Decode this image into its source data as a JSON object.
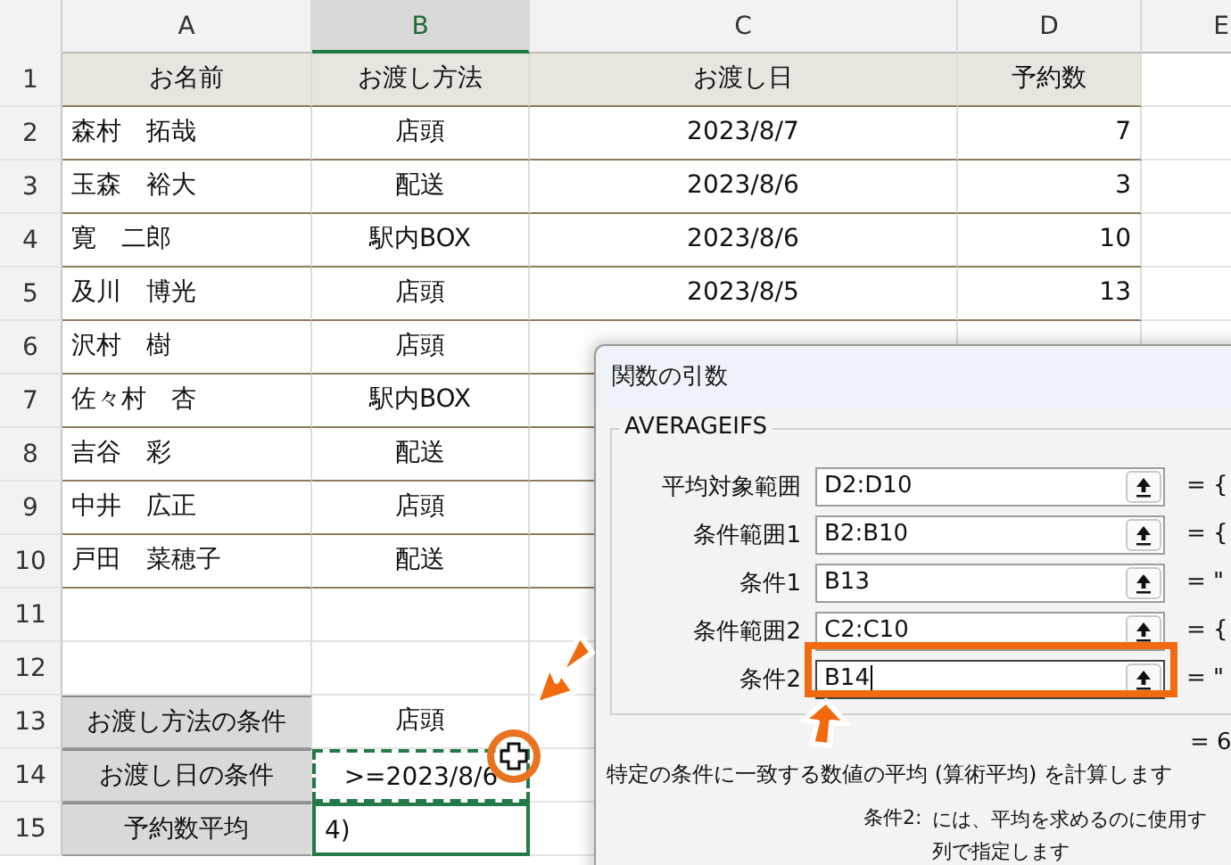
{
  "columns": [
    {
      "label": "A",
      "selected": false
    },
    {
      "label": "B",
      "selected": true
    },
    {
      "label": "C",
      "selected": false
    },
    {
      "label": "D",
      "selected": false
    },
    {
      "label": "E",
      "selected": false
    }
  ],
  "rows": [
    {
      "number": "1",
      "kind": "header",
      "cells": [
        "お名前",
        "お渡し方法",
        "お渡し日",
        "予約数"
      ]
    },
    {
      "number": "2",
      "kind": "data",
      "cells": [
        "森村　拓哉",
        "店頭",
        "2023/8/7",
        "7"
      ]
    },
    {
      "number": "3",
      "kind": "data",
      "cells": [
        "玉森　裕大",
        "配送",
        "2023/8/6",
        "3"
      ]
    },
    {
      "number": "4",
      "kind": "data",
      "cells": [
        "寛　二郎",
        "駅内BOX",
        "2023/8/6",
        "10"
      ]
    },
    {
      "number": "5",
      "kind": "data",
      "cells": [
        "及川　博光",
        "店頭",
        "2023/8/5",
        "13"
      ]
    },
    {
      "number": "6",
      "kind": "data",
      "cells": [
        "沢村　樹",
        "店頭"
      ]
    },
    {
      "number": "7",
      "kind": "data",
      "cells": [
        "佐々村　杏",
        "駅内BOX"
      ]
    },
    {
      "number": "8",
      "kind": "data",
      "cells": [
        "吉谷　彩",
        "配送"
      ]
    },
    {
      "number": "9",
      "kind": "data",
      "cells": [
        "中井　広正",
        "店頭"
      ]
    },
    {
      "number": "10",
      "kind": "data",
      "cells": [
        "戸田　菜穂子",
        "配送"
      ]
    },
    {
      "number": "11",
      "kind": "blank",
      "cells": []
    },
    {
      "number": "12",
      "kind": "blank",
      "cells": []
    },
    {
      "number": "13",
      "kind": "criteria",
      "cells": [
        "お渡し方法の条件",
        "店頭"
      ],
      "marquee": false,
      "editing": false
    },
    {
      "number": "14",
      "kind": "criteria",
      "cells": [
        "お渡し日の条件",
        ">=2023/8/6"
      ],
      "marquee": true,
      "editing": false
    },
    {
      "number": "15",
      "kind": "criteria",
      "cells": [
        "予約数平均",
        "4)"
      ],
      "marquee": false,
      "editing": true
    }
  ],
  "dialog": {
    "title": "関数の引数",
    "function_name": "AVERAGEIFS",
    "arguments": [
      {
        "label": "平均対象範囲",
        "value": "D2:D10",
        "result": "= {",
        "focused": false
      },
      {
        "label": "条件範囲1",
        "value": "B2:B10",
        "result": "= {",
        "focused": false
      },
      {
        "label": "条件1",
        "value": "B13",
        "result": "= \"",
        "focused": false
      },
      {
        "label": "条件範囲2",
        "value": "C2:C10",
        "result": "= {",
        "focused": false
      },
      {
        "label": "条件2",
        "value": "B14",
        "result": "= \"",
        "focused": true
      }
    ],
    "result": "= 6",
    "description": "特定の条件に一致する数値の平均 (算術平均) を計算します",
    "help_label": "条件2:",
    "help_lines": [
      "には、平均を求めるのに使用す",
      "列で指定します"
    ]
  }
}
